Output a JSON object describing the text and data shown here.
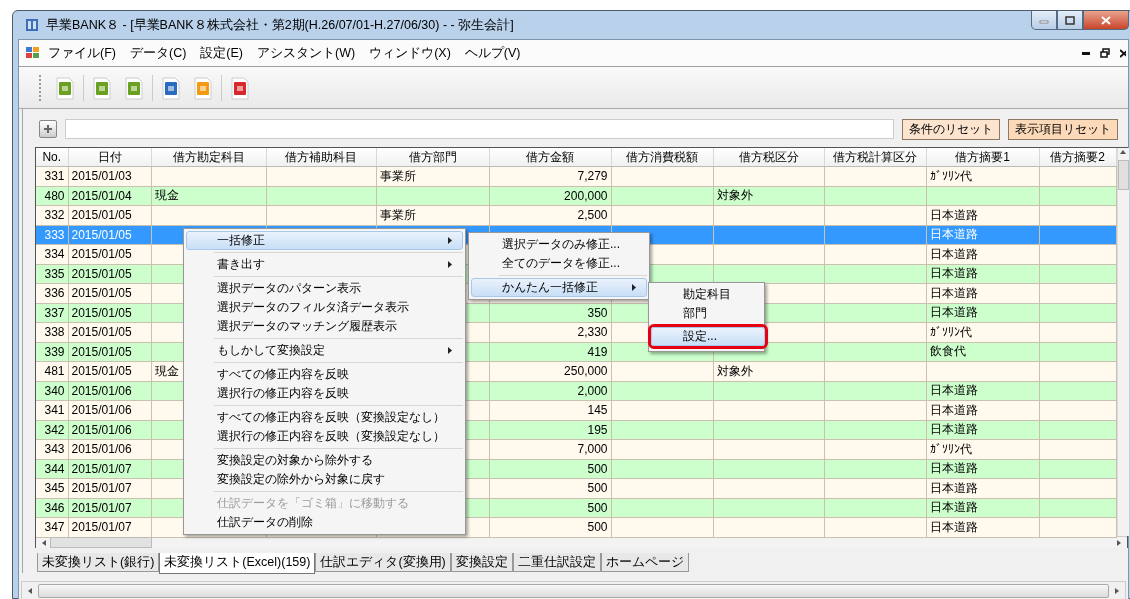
{
  "window": {
    "title": "早業BANK８ - [早業BANK８株式会社・第2期(H.26/07/01-H.27/06/30) - - 弥生会計]"
  },
  "menu_bar": [
    {
      "label": "ファイル(F)"
    },
    {
      "label": "データ(C)"
    },
    {
      "label": "設定(E)"
    },
    {
      "label": "アシスタント(W)"
    },
    {
      "label": "ウィンドウ(X)"
    },
    {
      "label": "ヘルプ(V)"
    }
  ],
  "toolbar": [
    {
      "color": "#6aa121"
    },
    {
      "color": "#6aa121"
    },
    {
      "color": "#6aa121"
    },
    {
      "color": "#2a6bbf"
    },
    {
      "color": "#f39a12"
    },
    {
      "color": "#d8282b"
    }
  ],
  "filter": {
    "buttons": [
      "条件のリセット",
      "表示項目リセット"
    ]
  },
  "table": {
    "columns": [
      "No.",
      "日付",
      "借方勘定科目",
      "借方補助科目",
      "借方部門",
      "借方金額",
      "借方消費税額",
      "借方税区分",
      "借方税計算区分",
      "借方摘要1",
      "借方摘要2"
    ],
    "rows": [
      {
        "cells": [
          "331",
          "2015/01/03",
          "",
          "",
          "事業所",
          "7,279",
          "",
          "",
          "",
          "ｶﾞｿﾘﾝ代",
          ""
        ],
        "selected": false
      },
      {
        "cells": [
          "480",
          "2015/01/04",
          "現金",
          "",
          "",
          "200,000",
          "",
          "対象外",
          "",
          "",
          ""
        ],
        "selected": false
      },
      {
        "cells": [
          "332",
          "2015/01/05",
          "",
          "",
          "事業所",
          "2,500",
          "",
          "",
          "",
          "日本道路",
          ""
        ],
        "selected": false
      },
      {
        "cells": [
          "333",
          "2015/01/05",
          "",
          "",
          "",
          "",
          "",
          "",
          "",
          "日本道路",
          ""
        ],
        "selected": true
      },
      {
        "cells": [
          "334",
          "2015/01/05",
          "",
          "",
          "",
          "",
          "",
          "",
          "",
          "日本道路",
          ""
        ],
        "selected": false
      },
      {
        "cells": [
          "335",
          "2015/01/05",
          "",
          "",
          "",
          "",
          "",
          "",
          "",
          "日本道路",
          ""
        ],
        "selected": false
      },
      {
        "cells": [
          "336",
          "2015/01/05",
          "",
          "",
          "",
          "",
          "",
          "",
          "",
          "日本道路",
          ""
        ],
        "selected": false
      },
      {
        "cells": [
          "337",
          "2015/01/05",
          "",
          "",
          "",
          "350",
          "",
          "",
          "",
          "日本道路",
          ""
        ],
        "selected": false
      },
      {
        "cells": [
          "338",
          "2015/01/05",
          "",
          "",
          "",
          "2,330",
          "",
          "",
          "",
          "ｶﾞｿﾘﾝ代",
          ""
        ],
        "selected": false
      },
      {
        "cells": [
          "339",
          "2015/01/05",
          "",
          "",
          "",
          "419",
          "",
          "",
          "",
          "飲食代",
          ""
        ],
        "selected": false
      },
      {
        "cells": [
          "481",
          "2015/01/05",
          "現金",
          "",
          "",
          "250,000",
          "",
          "対象外",
          "",
          "",
          ""
        ],
        "selected": false
      },
      {
        "cells": [
          "340",
          "2015/01/06",
          "",
          "",
          "",
          "2,000",
          "",
          "",
          "",
          "日本道路",
          ""
        ],
        "selected": false
      },
      {
        "cells": [
          "341",
          "2015/01/06",
          "",
          "",
          "",
          "145",
          "",
          "",
          "",
          "日本道路",
          ""
        ],
        "selected": false
      },
      {
        "cells": [
          "342",
          "2015/01/06",
          "",
          "",
          "",
          "195",
          "",
          "",
          "",
          "日本道路",
          ""
        ],
        "selected": false
      },
      {
        "cells": [
          "343",
          "2015/01/06",
          "",
          "",
          "",
          "7,000",
          "",
          "",
          "",
          "ｶﾞｿﾘﾝ代",
          ""
        ],
        "selected": false
      },
      {
        "cells": [
          "344",
          "2015/01/07",
          "",
          "",
          "",
          "500",
          "",
          "",
          "",
          "日本道路",
          ""
        ],
        "selected": false
      },
      {
        "cells": [
          "345",
          "2015/01/07",
          "",
          "",
          "",
          "500",
          "",
          "",
          "",
          "日本道路",
          ""
        ],
        "selected": false
      },
      {
        "cells": [
          "346",
          "2015/01/07",
          "",
          "",
          "",
          "500",
          "",
          "",
          "",
          "日本道路",
          ""
        ],
        "selected": false
      },
      {
        "cells": [
          "347",
          "2015/01/07",
          "",
          "",
          "",
          "500",
          "",
          "",
          "",
          "日本道路",
          ""
        ],
        "selected": false
      }
    ]
  },
  "context_menu": {
    "items": [
      {
        "kind": "item",
        "label": "一括修正",
        "submenu": true,
        "selected": true,
        "disabled": false
      },
      {
        "kind": "separator"
      },
      {
        "kind": "item",
        "label": "書き出す",
        "submenu": true,
        "selected": false,
        "disabled": false
      },
      {
        "kind": "separator"
      },
      {
        "kind": "item",
        "label": "選択データのパターン表示",
        "submenu": false,
        "selected": false,
        "disabled": false
      },
      {
        "kind": "item",
        "label": "選択データのフィルタ済データ表示",
        "submenu": false,
        "selected": false,
        "disabled": false
      },
      {
        "kind": "item",
        "label": "選択データのマッチング履歴表示",
        "submenu": false,
        "selected": false,
        "disabled": false
      },
      {
        "kind": "separator"
      },
      {
        "kind": "item",
        "label": "もしかして変換設定",
        "submenu": true,
        "selected": false,
        "disabled": false
      },
      {
        "kind": "separator"
      },
      {
        "kind": "item",
        "label": "すべての修正内容を反映",
        "submenu": false,
        "selected": false,
        "disabled": false
      },
      {
        "kind": "item",
        "label": "選択行の修正内容を反映",
        "submenu": false,
        "selected": false,
        "disabled": false
      },
      {
        "kind": "separator"
      },
      {
        "kind": "item",
        "label": "すべての修正内容を反映（変換設定なし）",
        "submenu": false,
        "selected": false,
        "disabled": false
      },
      {
        "kind": "item",
        "label": "選択行の修正内容を反映（変換設定なし）",
        "submenu": false,
        "selected": false,
        "disabled": false
      },
      {
        "kind": "separator"
      },
      {
        "kind": "item",
        "label": "変換設定の対象から除外する",
        "submenu": false,
        "selected": false,
        "disabled": false
      },
      {
        "kind": "item",
        "label": "変換設定の除外から対象に戻す",
        "submenu": false,
        "selected": false,
        "disabled": false
      },
      {
        "kind": "separator"
      },
      {
        "kind": "item",
        "label": "仕訳データを「ゴミ箱」に移動する",
        "submenu": false,
        "selected": false,
        "disabled": true
      },
      {
        "kind": "item",
        "label": "仕訳データの削除",
        "submenu": false,
        "selected": false,
        "disabled": false
      }
    ]
  },
  "submenu": {
    "items": [
      {
        "kind": "item",
        "label": "選択データのみ修正...",
        "submenu": false,
        "selected": false
      },
      {
        "kind": "item",
        "label": "全てのデータを修正...",
        "submenu": false,
        "selected": false
      },
      {
        "kind": "separator"
      },
      {
        "kind": "item",
        "label": "かんたん一括修正",
        "submenu": true,
        "selected": true
      }
    ]
  },
  "submenu_2": {
    "items": [
      {
        "label": "勘定科目",
        "selected": false,
        "outlined": false
      },
      {
        "label": "部門",
        "selected": false,
        "outlined": false
      },
      {
        "label": "設定...",
        "selected": true,
        "outlined": true
      }
    ]
  },
  "tabs": [
    {
      "label": "未変換リスト(銀行)",
      "selected": false
    },
    {
      "label": "未変換リスト(Excel)(159)",
      "selected": true
    },
    {
      "label": "仕訳エディタ(変換用)",
      "selected": false
    },
    {
      "label": "変換設定",
      "selected": false
    },
    {
      "label": "二重仕訳設定",
      "selected": false
    },
    {
      "label": "ホームページ",
      "selected": false
    }
  ]
}
